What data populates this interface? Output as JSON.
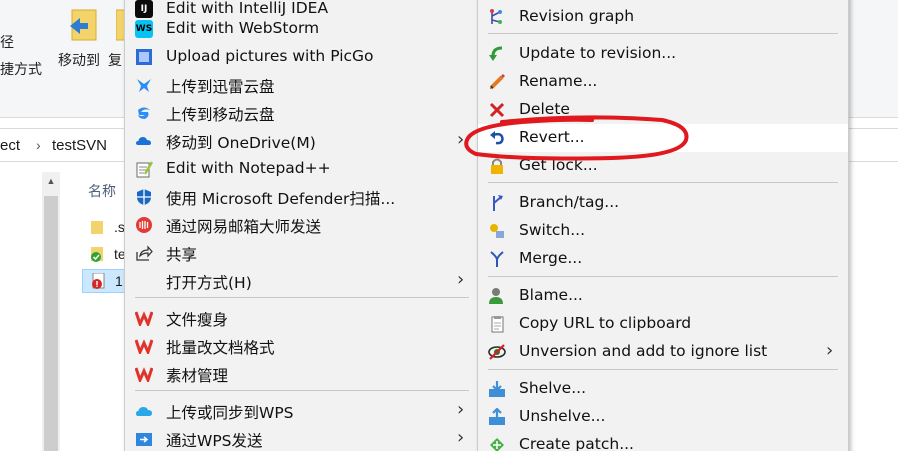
{
  "ribbon": {
    "left_text_1": "径",
    "left_text_2": "捷方式",
    "move_to_label": "移动到",
    "copy_to_label": "复"
  },
  "address": {
    "segment_1": "ect",
    "segment_2": "testSVN"
  },
  "file_list": {
    "column_name": "名称",
    "rows": [
      {
        "name": ".s"
      },
      {
        "name": "te"
      },
      {
        "name": "1"
      }
    ]
  },
  "context_menu": {
    "items": [
      {
        "label": "Edit with IntelliJ IDEA",
        "icon": "intellij-icon"
      },
      {
        "label": "Edit with WebStorm",
        "icon": "webstorm-icon"
      },
      {
        "label": "Upload pictures with PicGo",
        "icon": "picgo-icon"
      },
      {
        "label": "上传到迅雷云盘",
        "icon": "xunlei-icon"
      },
      {
        "label": "上传到移动云盘",
        "icon": "mobile-cloud-icon"
      },
      {
        "label": "移动到 OneDrive(M)",
        "icon": "onedrive-icon",
        "submenu": true
      },
      {
        "label": "Edit with Notepad++",
        "icon": "notepadpp-icon"
      },
      {
        "label": "使用 Microsoft Defender扫描...",
        "icon": "defender-icon"
      },
      {
        "label": "通过网易邮箱大师发送",
        "icon": "netease-mail-icon"
      },
      {
        "label": "共享",
        "icon": "share-icon"
      },
      {
        "label": "打开方式(H)",
        "icon": "",
        "submenu": true
      },
      {
        "label": "文件瘦身",
        "icon": "wps-icon"
      },
      {
        "label": "批量改文档格式",
        "icon": "wps-icon"
      },
      {
        "label": "素材管理",
        "icon": "wps-icon"
      },
      {
        "label": "上传或同步到WPS",
        "icon": "wps-cloud-icon",
        "submenu": true
      },
      {
        "label": "通过WPS发送",
        "icon": "wps-send-icon",
        "submenu": true
      }
    ],
    "arrow_glyph": "›"
  },
  "svn_menu": {
    "items": [
      {
        "label": "Revision graph",
        "icon": "revision-graph-icon"
      },
      {
        "label": "Update to revision...",
        "icon": "update-icon"
      },
      {
        "label": "Rename...",
        "icon": "rename-icon"
      },
      {
        "label": "Delete",
        "icon": "delete-icon"
      },
      {
        "label": "Revert...",
        "icon": "revert-icon"
      },
      {
        "label": "Get lock...",
        "icon": "lock-icon"
      },
      {
        "label": "Branch/tag...",
        "icon": "branch-icon"
      },
      {
        "label": "Switch...",
        "icon": "switch-icon"
      },
      {
        "label": "Merge...",
        "icon": "merge-icon"
      },
      {
        "label": "Blame...",
        "icon": "blame-icon"
      },
      {
        "label": "Copy URL to clipboard",
        "icon": "copy-url-icon"
      },
      {
        "label": "Unversion and add to ignore list",
        "icon": "unversion-icon",
        "submenu": true
      },
      {
        "label": "Shelve...",
        "icon": "shelve-icon"
      },
      {
        "label": "Unshelve...",
        "icon": "unshelve-icon"
      },
      {
        "label": "Create patch...",
        "icon": "patch-icon"
      }
    ],
    "highlighted": "Revert...",
    "annotation_color": "#e0191f"
  }
}
